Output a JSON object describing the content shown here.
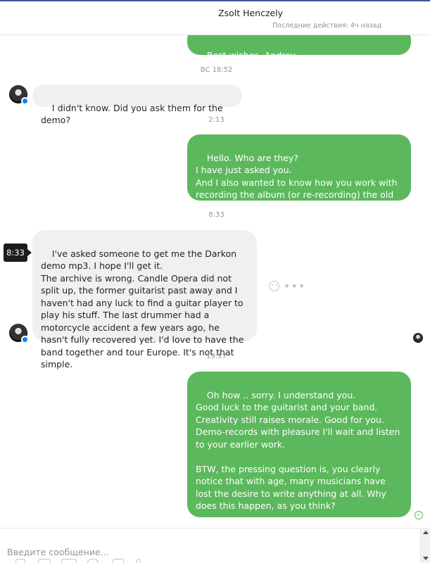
{
  "header": {
    "contact_name": "Zsolt Henczely",
    "last_active": "Последние действия: 4ч назад"
  },
  "messages": [
    {
      "dir": "out",
      "text": "Best wishes, Andrey"
    },
    {
      "dir": "in",
      "text": "I didn't know. Did you ask them for the demo?"
    },
    {
      "dir": "out",
      "text": "Hello. Who are they?\nI have just asked you.\nAnd I also wanted to know how you work with recording the album (or re-recording) the old songs of the band Candle Opera?.."
    },
    {
      "dir": "in",
      "text": "I've asked someone to get me the Darkon demo mp3. I hope I'll get it.\nThe archive is wrong. Candle Opera did not split up, the former guitarist past away and I haven't had any luck to find a guitar player to play his stuff. The last drummer had a motorcycle accident a few years ago, he hasn't fully recovered yet. I'd love to have the band together and tour Europe. It's not that simple."
    },
    {
      "dir": "out",
      "text": "Oh how .. sorry. I understand you.\nGood luck to the guitarist and your band.\nCreativity still raises morale. Good for you.\nDemo-records with pleasure I'll wait and listen to your earlier work.\n\nBTW, the pressing question is, you clearly notice that with age, many musicians have lost the desire to write anything at all. Why does this happen, as you think?\n\nCheers, Andrey"
    }
  ],
  "timestamps": [
    "ВС 18:52",
    "2:13",
    "8:33",
    "13:17"
  ],
  "hover_time": "8:33",
  "composer": {
    "placeholder": "Введите сообщение..."
  },
  "icons": {
    "avatar": "contact-avatar",
    "messenger_badge": "messenger-badge-icon",
    "react": "smiley-icon",
    "more": "more-icon",
    "delivered": "check-circle-icon"
  },
  "colors": {
    "outgoing_bubble": "#5cb85c",
    "incoming_bubble": "#f1f0f0",
    "header_line": "#3b5998"
  }
}
